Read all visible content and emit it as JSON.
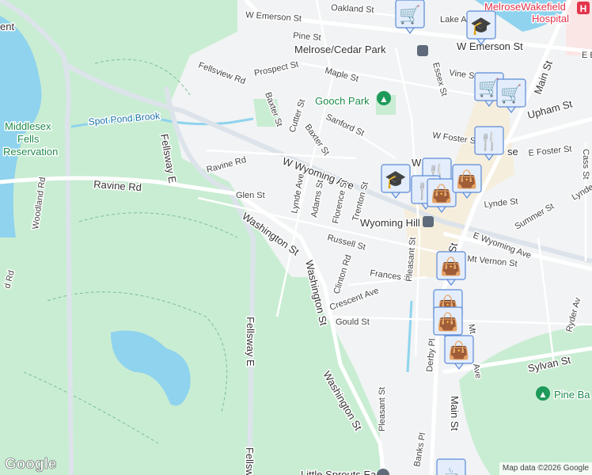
{
  "map": {
    "colors": {
      "background": "#f1f3f4",
      "park": "#c9edd3",
      "water": "#8fd3ee",
      "marker_fill": "#e4edfc",
      "marker_icon": "#0b4a6e"
    },
    "places": {
      "middlesex_1": "Middlesex",
      "middlesex_2": "Fells",
      "middlesex_3": "Reservation",
      "spot_pond_brook": "Spot Pond Brook",
      "gooch_park": "Gooch Park",
      "pine_banks": "Pine Ba",
      "hospital_1": "MelroseWakefield",
      "hospital_2": "Hospital",
      "melrose_cedar_park": "Melrose/Cedar Park",
      "wyoming_hill": "Wyoming Hill",
      "little_sprouts": "Little Sprouts Early",
      "melrose_partial": "se",
      "ent_partial": "ent"
    },
    "streets": {
      "w_emerson_top": "W Emerson St",
      "oakland": "Oakland St",
      "lake_ave": "Lake Av",
      "pine": "Pine St",
      "w_emerson": "W Emerson St",
      "e_emerson": "E E",
      "fellsview": "Fellsview Rd",
      "prospect": "Prospect St",
      "maple": "Maple St",
      "essex": "Essex St",
      "vine": "Vine St",
      "main_top": "Main St",
      "upham": "Upham St",
      "baxter1": "Baxter St",
      "cutter": "Cutter St",
      "baxter2": "Baxter St",
      "sanford": "Sanford St",
      "w_foster": "W Foster St",
      "e_foster": "E Foster St",
      "cass": "Cass St",
      "fellsway_e": "Fellsway E",
      "ravine_rd1": "Ravine Rd",
      "ravine_rd2": "Ravine Rd",
      "w_wyoming": "W Wyoming Ave",
      "woodland": "Woodland Rd",
      "d_rd": "d Rd",
      "glen": "Glen St",
      "lynde_ave": "Lynde Ave",
      "adams": "Adams St",
      "florence": "Florence St",
      "trenton": "Trenton St",
      "lynde_st": "Lynde St",
      "lynde_right": "Lynde",
      "washington1": "Washington St",
      "russell": "Russell St",
      "e_wyoming": "E Wyoming Ave",
      "summer": "Summer St",
      "mt_vernon": "Mt Vernon St",
      "washington2": "Washington St",
      "clinton": "Clinton Rd",
      "frances": "Frances St",
      "pleasant1": "Pleasant St",
      "crescent": "Crescent Ave",
      "derby": "Derby Pl",
      "ryder": "Ryder Av",
      "gould": "Gould St",
      "mt_ave": "Mt",
      "ave": "Ave",
      "sylvan": "Sylvan St",
      "fellsway_e2": "Fellsway E",
      "washington3": "Washington St",
      "pleasant2": "Pleasant St",
      "banks": "Banks Pl",
      "main_bottom": "Main St",
      "fellsway_bottom": "Fellsw",
      "main_mid": "St",
      "w_partial": "W"
    },
    "markers": [
      {
        "icon": "shopping-cart-icon",
        "glyph": "🛒"
      },
      {
        "icon": "graduation-cap-icon",
        "glyph": "🎓"
      },
      {
        "icon": "shopping-cart-icon",
        "glyph": "🛒"
      },
      {
        "icon": "shopping-cart-icon",
        "glyph": "🛒"
      },
      {
        "icon": "restaurant-icon",
        "glyph": "🍴"
      },
      {
        "icon": "restaurant-icon",
        "glyph": "🍴"
      },
      {
        "icon": "graduation-cap-icon",
        "glyph": "🎓"
      },
      {
        "icon": "restaurant-icon",
        "glyph": "🍴"
      },
      {
        "icon": "shopping-bag-icon",
        "glyph": "👜"
      },
      {
        "icon": "shopping-bag-icon",
        "glyph": "👜"
      },
      {
        "icon": "shopping-bag-icon",
        "glyph": "👜"
      },
      {
        "icon": "shopping-bag-icon",
        "glyph": "👜"
      },
      {
        "icon": "shopping-bag-icon",
        "glyph": "👜"
      },
      {
        "icon": "shopping-bag-icon",
        "glyph": "👜"
      },
      {
        "icon": "cafe-icon",
        "glyph": "☕"
      }
    ],
    "logo": "Google",
    "attribution": "Map data ©2026 Google"
  }
}
